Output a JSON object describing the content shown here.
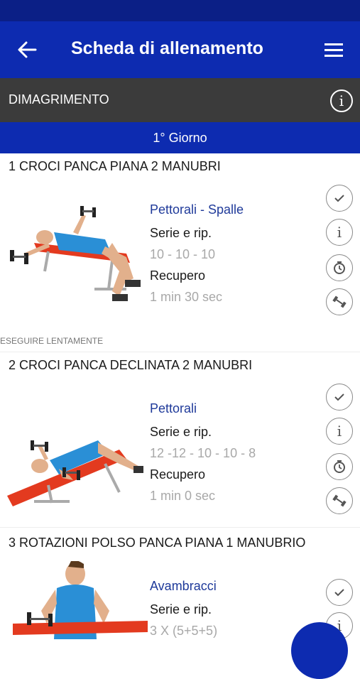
{
  "header": {
    "title": "Scheda di allenamento"
  },
  "program": {
    "name": "DIMAGRIMENTO",
    "info_icon": "i"
  },
  "day": {
    "label": "1° Giorno"
  },
  "exercises": [
    {
      "title": "1 CROCI PANCA PIANA 2 MANUBRI",
      "muscles": "Pettorali - Spalle",
      "sets_label": "Serie e rip.",
      "sets_value": "10 - 10 - 10",
      "rest_label": "Recupero",
      "rest_value": "1 min 30 sec",
      "note": "ESEGUIRE LENTAMENTE"
    },
    {
      "title": "2 CROCI PANCA DECLINATA 2 MANUBRI",
      "muscles": "Pettorali",
      "sets_label": "Serie e rip.",
      "sets_value": "12 -12 - 10 - 10 - 8",
      "rest_label": "Recupero",
      "rest_value": "1 min 0 sec"
    },
    {
      "title": "3 ROTAZIONI POLSO PANCA PIANA 1 MANUBRIO",
      "muscles": "Avambracci",
      "sets_label": "Serie e rip.",
      "sets_value": "3 X (5+5+5)"
    }
  ],
  "icons": [
    "back-arrow-icon",
    "hamburger-menu-icon",
    "info-icon",
    "check-icon",
    "timer-icon",
    "dumbbell-icon"
  ],
  "colors": {
    "primary": "#0d2bb0",
    "status": "#0b1f86",
    "section": "#3b3b3b",
    "muscle_text": "#1f3a9a",
    "muted": "#a8a8a8"
  }
}
